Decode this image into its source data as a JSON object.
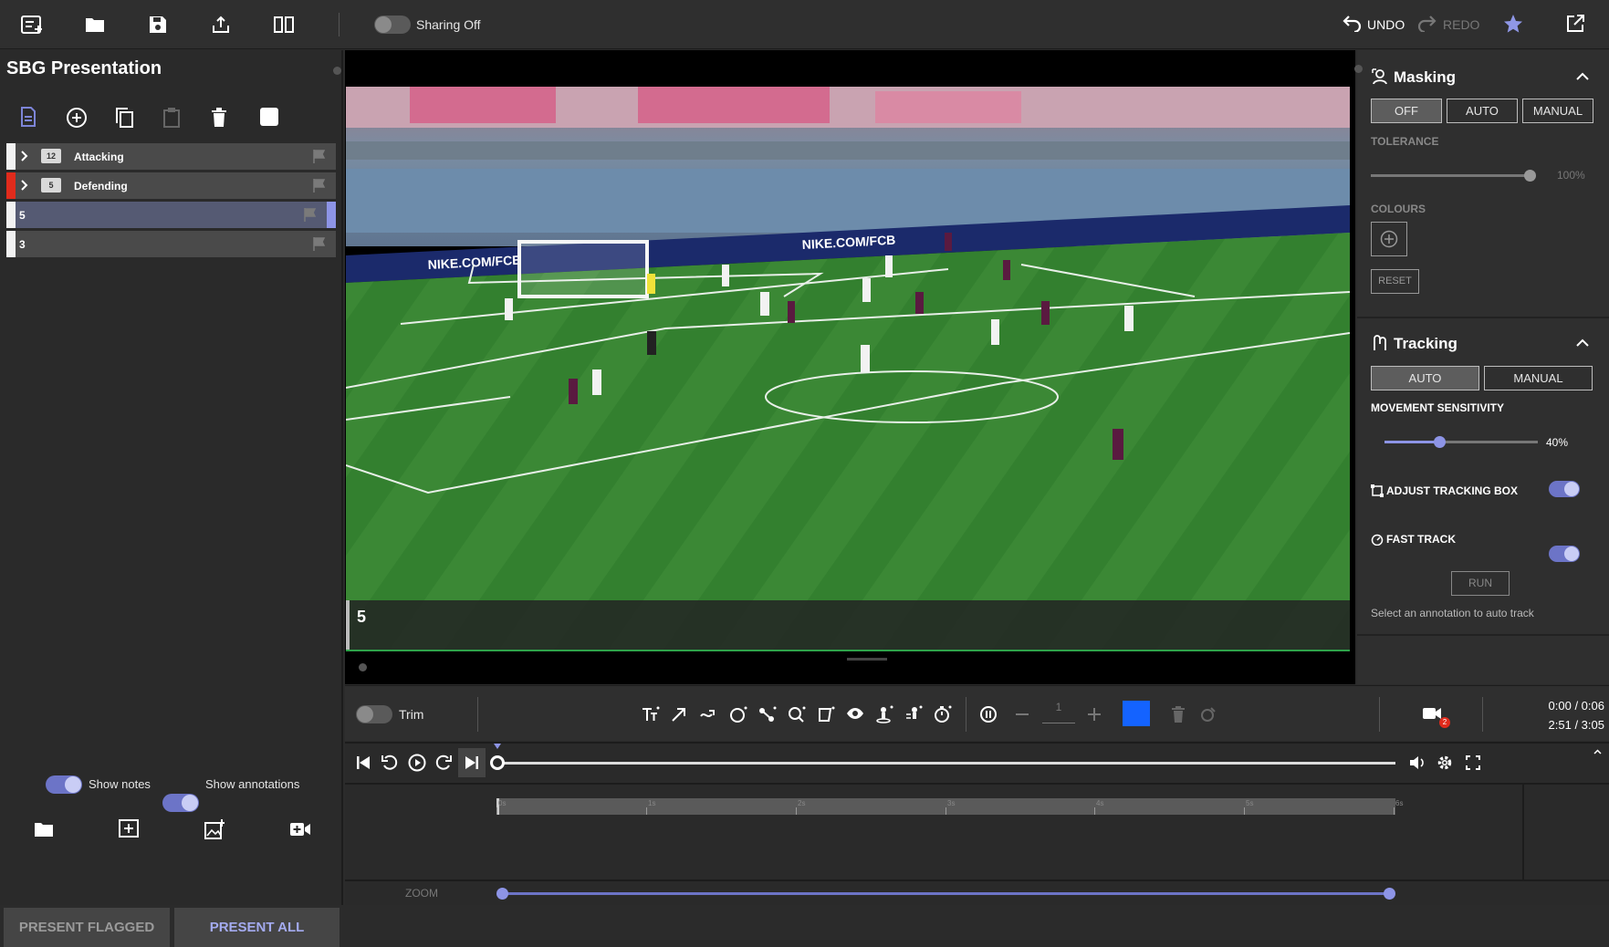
{
  "topbar": {
    "sharing_label": "Sharing Off",
    "undo_label": "UNDO",
    "redo_label": "REDO"
  },
  "left_panel": {
    "title": "SBG Presentation",
    "rows": [
      {
        "label": "Attacking",
        "count": "12",
        "accent": "#f2f2f2"
      },
      {
        "label": "Defending",
        "count": "5",
        "accent": "#e02b1c"
      },
      {
        "label": "5"
      },
      {
        "label": "3"
      }
    ],
    "show_notes_label": "Show notes",
    "show_annotations_label": "Show annotations",
    "present_flagged_label": "PRESENT FLAGGED",
    "present_all_label": "PRESENT ALL"
  },
  "video": {
    "clip_label": "5",
    "banner_text": "NIKE.COM/FCB"
  },
  "masking": {
    "title": "Masking",
    "modes": [
      "OFF",
      "AUTO",
      "MANUAL"
    ],
    "active_mode": "OFF",
    "tolerance_label": "TOLERANCE",
    "tolerance_value": "100%",
    "tolerance_fraction": 1.0,
    "colours_label": "COLOURS",
    "reset_label": "RESET"
  },
  "tracking": {
    "title": "Tracking",
    "modes": [
      "AUTO",
      "MANUAL"
    ],
    "active_mode": "AUTO",
    "sensitivity_label": "MOVEMENT SENSITIVITY",
    "sensitivity_value": "40%",
    "sensitivity_fraction": 0.4,
    "adjust_box_label": "ADJUST TRACKING BOX",
    "fast_track_label": "FAST TRACK",
    "run_label": "RUN",
    "hint": "Select an annotation to auto track"
  },
  "tools": {
    "trim_label": "Trim",
    "stroke_value": "1",
    "color": "#1463ff",
    "camera_badge": "2",
    "time_clip": "0:00 / 0:06",
    "time_total": "2:51 / 3:05"
  },
  "timeline": {
    "ticks": [
      "0s",
      "1s",
      "2s",
      "3s",
      "4s",
      "5s",
      "6s"
    ]
  },
  "zoom": {
    "label": "ZOOM"
  }
}
